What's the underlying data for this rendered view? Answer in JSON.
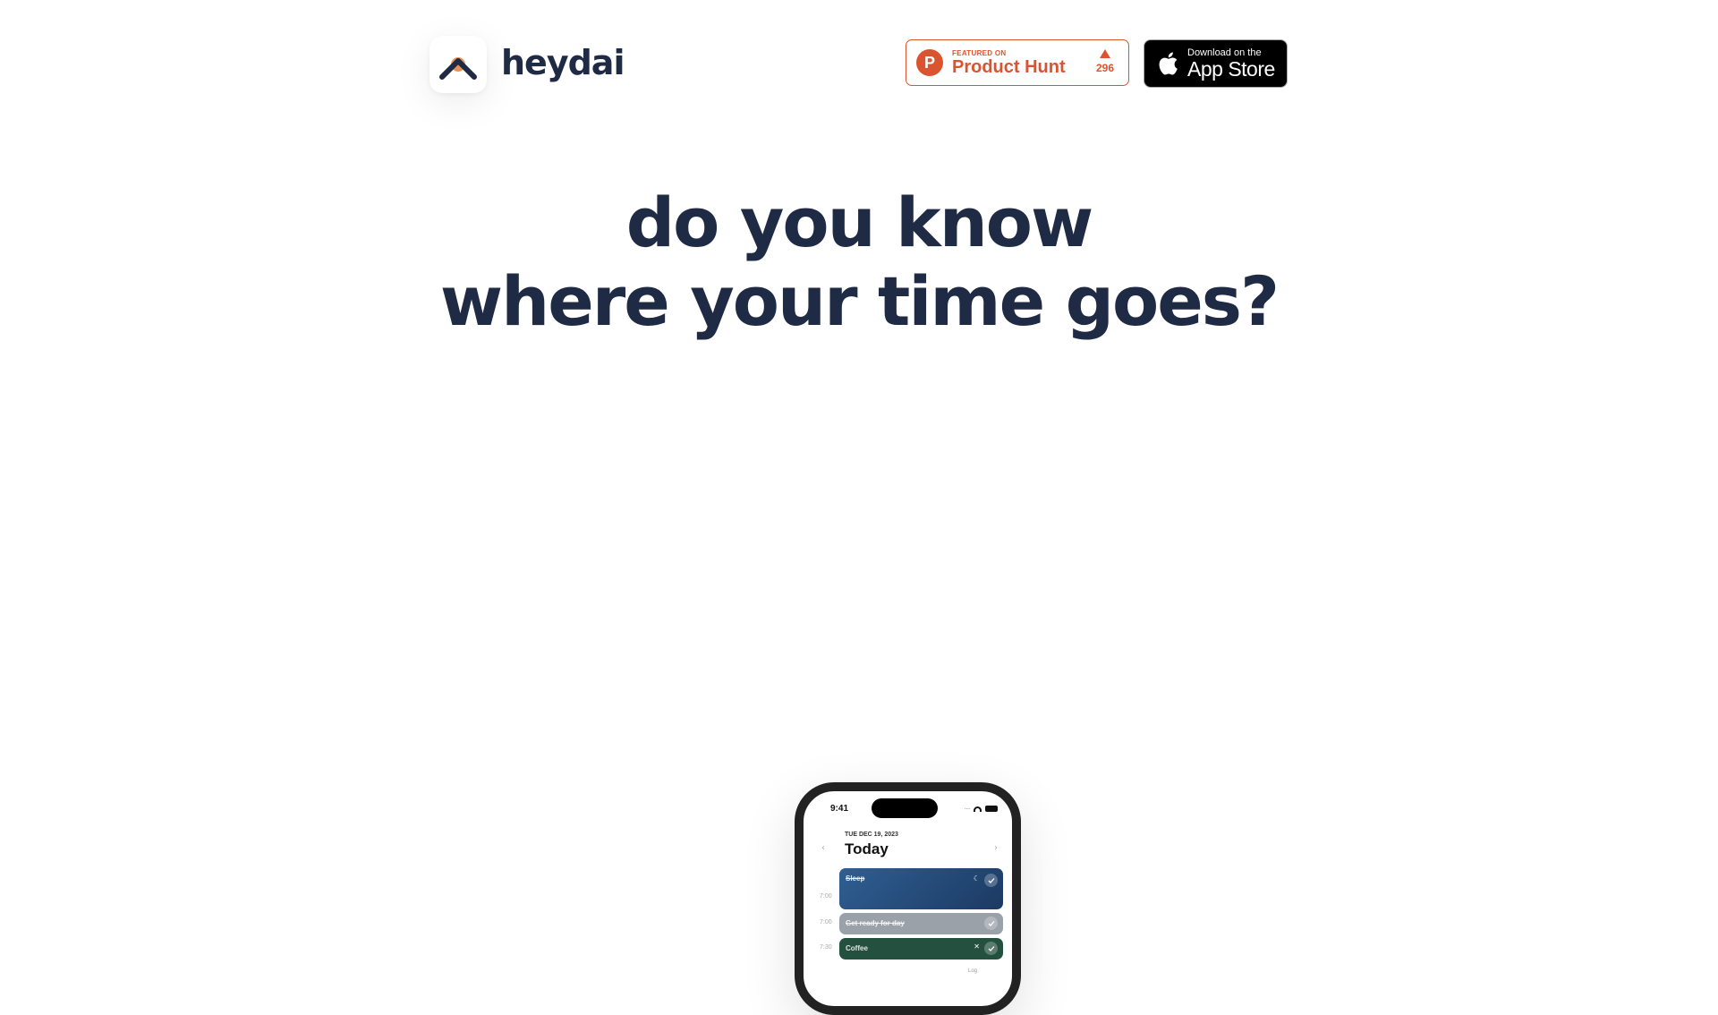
{
  "brand": {
    "name": "heydai"
  },
  "header": {
    "product_hunt": {
      "small": "FEATURED ON",
      "big": "Product Hunt",
      "votes": "296",
      "logo_letter": "P",
      "color": "#da552f"
    },
    "app_store": {
      "small": "Download on the",
      "big": "App Store"
    }
  },
  "hero": {
    "line1": "do you know",
    "line2": "where your time goes?"
  },
  "phone": {
    "status_time": "9:41",
    "status_dots": "····",
    "date": "TUE DEC 19, 2023",
    "title": "Today",
    "times": [
      "7:00",
      "7:00",
      "7:30"
    ],
    "events": [
      {
        "name": "Sleep",
        "icon": "moon-icon"
      },
      {
        "name": "Get ready for day",
        "icon": ""
      },
      {
        "name": "Coffee",
        "icon": "fork-knife-icon"
      }
    ],
    "log_label": "Log"
  },
  "colors": {
    "text": "#1f2a44",
    "accent_orange": "#e8925a"
  }
}
